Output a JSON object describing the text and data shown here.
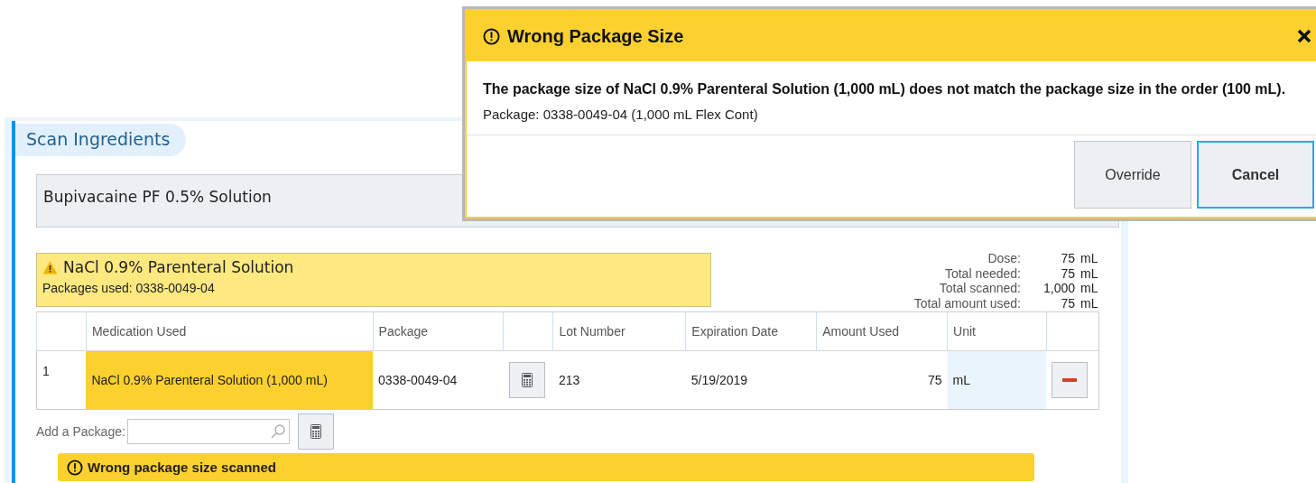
{
  "panel": {
    "title": "Scan Ingredients",
    "order_item": "Bupivacaine PF 0.5% Solution",
    "ingredient": {
      "name": "NaCl 0.9% Parenteral Solution",
      "packages_used": "Packages used: 0338-0049-04",
      "warning": true
    },
    "summary": [
      {
        "label": "Dose:",
        "value": "75",
        "unit": "mL"
      },
      {
        "label": "Total needed:",
        "value": "75",
        "unit": "mL"
      },
      {
        "label": "Total scanned:",
        "value": "1,000",
        "unit": "mL"
      },
      {
        "label": "Total amount used:",
        "value": "75",
        "unit": "mL"
      }
    ],
    "table": {
      "columns": [
        "Medication Used",
        "Package",
        "Lot Number",
        "Expiration Date",
        "Amount Used",
        "Unit"
      ],
      "rows": [
        {
          "index": "1",
          "medication": "NaCl 0.9% Parenteral Solution (1,000 mL)",
          "package": "0338-0049-04",
          "lot": "213",
          "expiration": "5/19/2019",
          "amount": "75",
          "unit": "mL",
          "warning": true
        }
      ]
    },
    "add_package": {
      "label": "Add a Package:"
    },
    "alert": "Wrong package size scanned"
  },
  "dialog": {
    "title": "Wrong Package Size",
    "message": "The package size of NaCl 0.9% Parenteral Solution (1,000 mL) does not match the package size in the order (100 mL).",
    "detail": "Package: 0338-0049-04 (1,000 mL Flex Cont)",
    "buttons": [
      {
        "label": "Override",
        "selected": false
      },
      {
        "label": "Cancel",
        "selected": true
      }
    ]
  }
}
